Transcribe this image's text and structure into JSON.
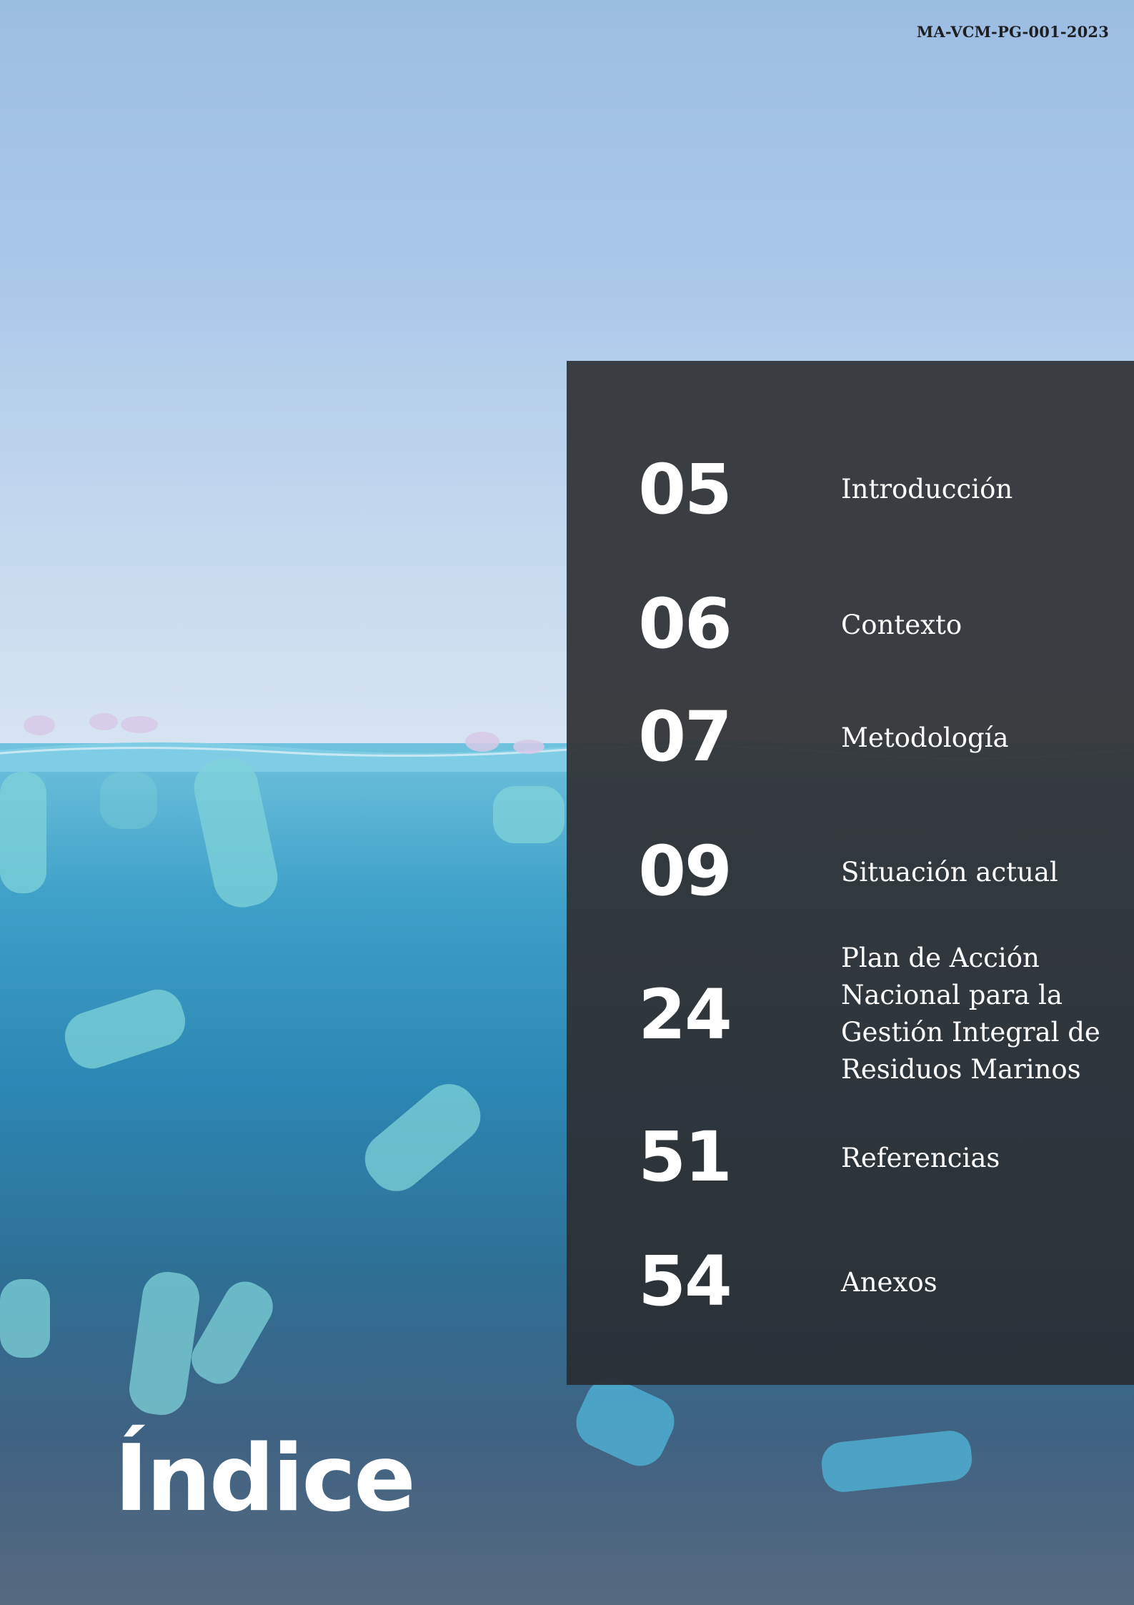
{
  "document": {
    "code": "MA-VCM-PG-001-2023",
    "heading": "Índice"
  },
  "toc": [
    {
      "page": "05",
      "title": "Introducción"
    },
    {
      "page": "06",
      "title": "Contexto"
    },
    {
      "page": "07",
      "title": "Metodología"
    },
    {
      "page": "09",
      "title": "Situación actual"
    },
    {
      "page": "24",
      "title": "Plan de Acción Nacional para la Gestión Integral de Residuos Marinos"
    },
    {
      "page": "51",
      "title": "Referencias"
    },
    {
      "page": "54",
      "title": "Anexos"
    }
  ],
  "colors": {
    "panel": "#343639",
    "text": "#ffffff",
    "sky": "#a9c7e8",
    "sea": "#2b87b3"
  }
}
